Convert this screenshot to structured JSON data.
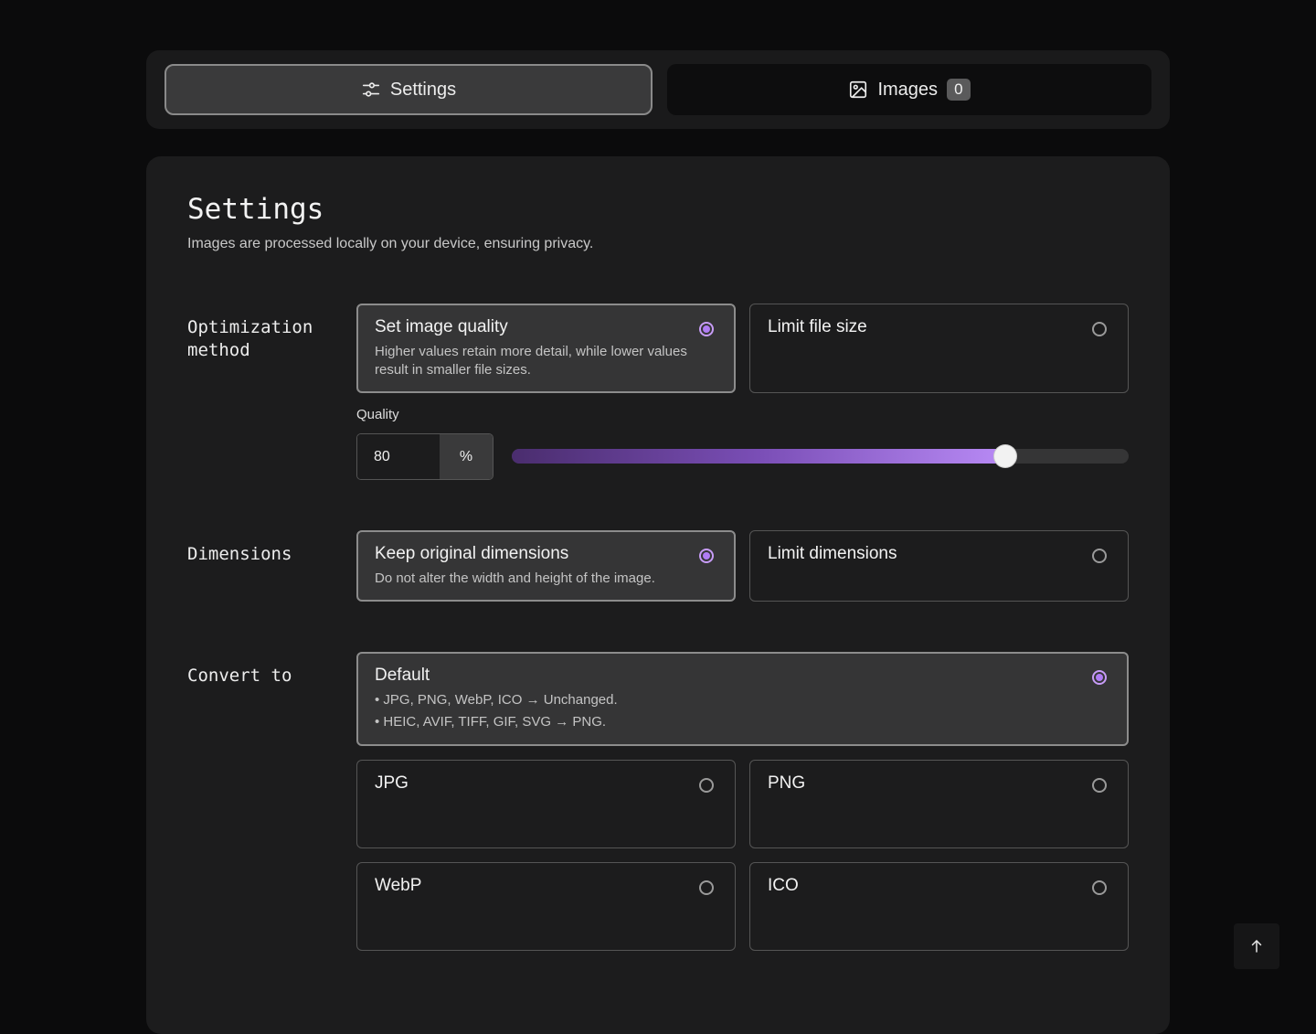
{
  "tabs": [
    {
      "label": "Settings",
      "icon": "sliders-icon",
      "active": true
    },
    {
      "label": "Images",
      "icon": "image-icon",
      "badge": "0",
      "active": false
    }
  ],
  "settings": {
    "title": "Settings",
    "subtitle": "Images are processed locally on your device, ensuring privacy."
  },
  "optimization": {
    "label": "Optimization method",
    "options": [
      {
        "title": "Set image quality",
        "description": "Higher values retain more detail, while lower values result in smaller file sizes.",
        "selected": true
      },
      {
        "title": "Limit file size",
        "description": "",
        "selected": false
      }
    ],
    "quality": {
      "label": "Quality",
      "value": "80",
      "unit": "%",
      "fraction": 0.8
    }
  },
  "dimensions": {
    "label": "Dimensions",
    "options": [
      {
        "title": "Keep original dimensions",
        "description": "Do not alter the width and height of the image.",
        "selected": true
      },
      {
        "title": "Limit dimensions",
        "description": "",
        "selected": false
      }
    ]
  },
  "convert": {
    "label": "Convert to",
    "default": {
      "title": "Default",
      "line1": "• JPG, PNG, WebP, ICO → Unchanged.",
      "line2": "• HEIC, AVIF, TIFF, GIF, SVG → PNG.",
      "selected": true
    },
    "options": [
      {
        "title": "JPG",
        "selected": false
      },
      {
        "title": "PNG",
        "selected": false
      },
      {
        "title": "WebP",
        "selected": false
      },
      {
        "title": "ICO",
        "selected": false
      }
    ]
  },
  "colors": {
    "accent": "#b07cf4",
    "background": "#0b0b0c",
    "card": "#1c1c1d"
  }
}
